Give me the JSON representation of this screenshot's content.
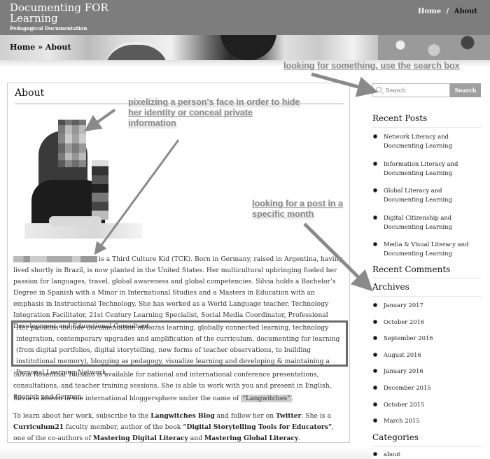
{
  "header": {
    "site_title": "Documenting FOR Learning",
    "tagline": "Pedagogical Documentation",
    "nav": {
      "home": "Home",
      "separator": "/",
      "current": "About"
    }
  },
  "banner": {
    "breadcrumb": "Home » About"
  },
  "main": {
    "title": "About",
    "photo_alt": "Pixelated portrait of a woman seated at a table",
    "paragraphs": {
      "p1_after_name": "is a Third Culture Kid (TCK). Born in Germany, raised in Argentina, having lived shortly in Brazil, is now planted in the United States. Her multicultural upbringing fueled her passion for languages, travel, global awareness and global competencies. Silvia holds a Bachelor’s Degree in Spanish with a Minor in International Studies and a Masters in Education with an emphasis in Instructional Technology. She has worked as a World Language teacher, Technology Integration Facilitator, 21st Century Learning Specialist, Social Media Coordinator, Professional Development and Educational Consultant.",
      "p2": "Her passions include documentation of/for/as learning, globally connected learning, technology integration,  contemporary upgrades and amplification of the curriculum, documenting for learning (from digital portfolios, digital storytelling, new forms of teacher observations, to building institutional memory), blogging as pedagogy, visualize learning and developing & maintaining a Personal Learning Network.",
      "p3": "Silvia Rosenthal Tolisano is available for national and international conference presentations, consultations, and teacher training sessions. She is able to work with you and present in English, Spanish and German.",
      "p4_prefix": "Silvia is known in the international bloggersphere under the name of ",
      "p4_quoted": "“Langwitches”",
      "p4_suffix": ".",
      "p5": {
        "t1": "To learn about her work, subscribe to the ",
        "link1": "Langwitches Blog",
        "t2": " and follow her on ",
        "link2": "Twitter",
        "t3": ". She is a ",
        "link3": "Curriculum21",
        "t4": " faculty member,  author of the book ",
        "link4": "“Digital Storytelling Tools for Educators”",
        "t5": ", one of the co-authors of ",
        "link5": "Mastering Digital Literacy",
        "t6": " and  ",
        "link6": "Mastering Global Literacy",
        "t7": "."
      }
    }
  },
  "sidebar": {
    "search": {
      "placeholder": "Search",
      "button_label": "Search",
      "icon": "search-icon"
    },
    "recent_posts": {
      "title": "Recent Posts",
      "items": [
        "Network Literacy and Documenting Learning",
        "Information Literacy and Documenting Learning",
        "Global Literacy and Documenting Learning",
        "Digital Citizenship and Documenting Learning",
        "Media & Visual Literacy and Documenting Learning"
      ]
    },
    "recent_comments": {
      "title": "Recent Comments"
    },
    "archives": {
      "title": "Archives",
      "items": [
        "January 2017",
        "October 2016",
        "September 2016",
        "August 2016",
        "January 2016",
        "December 2015",
        "October 2015",
        "March 2015"
      ]
    },
    "categories": {
      "title": "Categories",
      "items": [
        "about"
      ]
    }
  },
  "annotations": {
    "search": "looking for something, use the search box",
    "face": "pixelizing a person's face in order to hide her identity or conceal private information",
    "archive": "looking for a post in a specific month"
  }
}
